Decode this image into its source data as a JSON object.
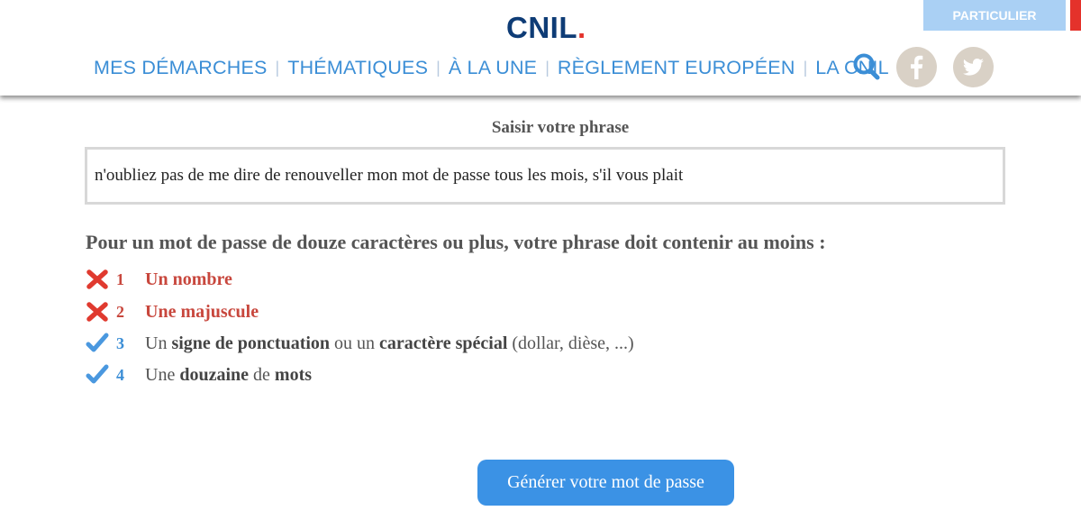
{
  "header": {
    "logo": {
      "text": "CNIL",
      "dot": "."
    },
    "top_button": "PARTICULIER",
    "nav": [
      "MES DÉMARCHES",
      "THÉMATIQUES",
      "À LA UNE",
      "RÈGLEMENT EUROPÉEN",
      "LA CNIL"
    ],
    "nav_separator": "|",
    "icons": [
      "search-icon",
      "facebook-icon",
      "twitter-icon"
    ]
  },
  "form": {
    "label": "Saisir votre phrase",
    "phrase_value": "n'oubliez pas de me dire de renouveller mon mot de passe tous les mois, s'il vous plait",
    "requirement_title": "Pour un mot de passe de douze caractères ou plus, votre phrase doit contenir au moins :",
    "criteria": [
      {
        "number": "1",
        "status": "fail",
        "text": "Un nombre"
      },
      {
        "number": "2",
        "status": "fail",
        "text": "Une majuscule"
      },
      {
        "number": "3",
        "status": "ok",
        "parts": [
          "Un ",
          "signe de ponctuation",
          " ou un ",
          "caractère spécial",
          " (dollar, dièse, ...)"
        ]
      },
      {
        "number": "4",
        "status": "ok",
        "parts": [
          "Une ",
          "douzaine",
          " de ",
          "mots"
        ]
      }
    ],
    "button": "Générer votre mot de passe"
  },
  "colors": {
    "brand_blue": "#3b8ed6",
    "logo_navy": "#0e3c76",
    "fail_red": "#c8473d",
    "button_blue": "#3b92e5",
    "particulier_bg": "#aad0f4"
  }
}
